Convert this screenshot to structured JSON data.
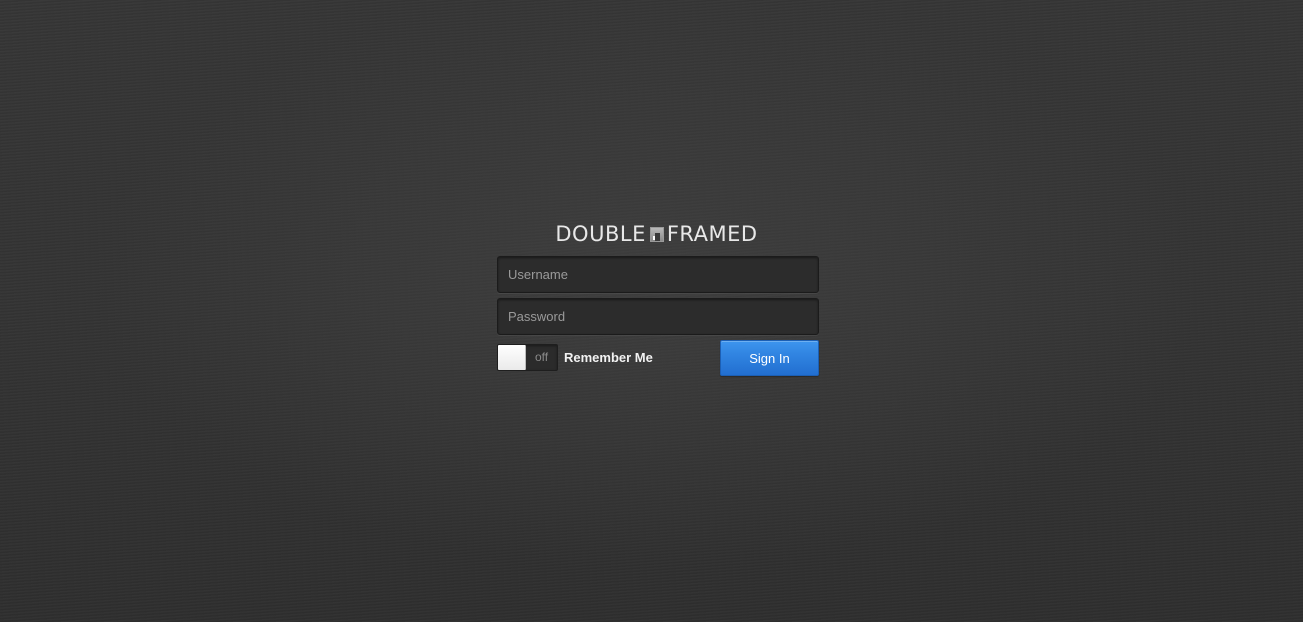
{
  "logo": {
    "left_text": "DOUBLE",
    "right_text": "FRAMED",
    "mark_icon": "framed-picture-icon"
  },
  "form": {
    "username_placeholder": "Username",
    "username_value": "",
    "password_placeholder": "Password",
    "password_value": "",
    "remember": {
      "toggle_state": "off",
      "label": "Remember Me"
    },
    "signin_label": "Sign In"
  },
  "colors": {
    "background": "#363636",
    "accent_button": "#2f82e0",
    "logo_text": "#e8e8e8"
  }
}
